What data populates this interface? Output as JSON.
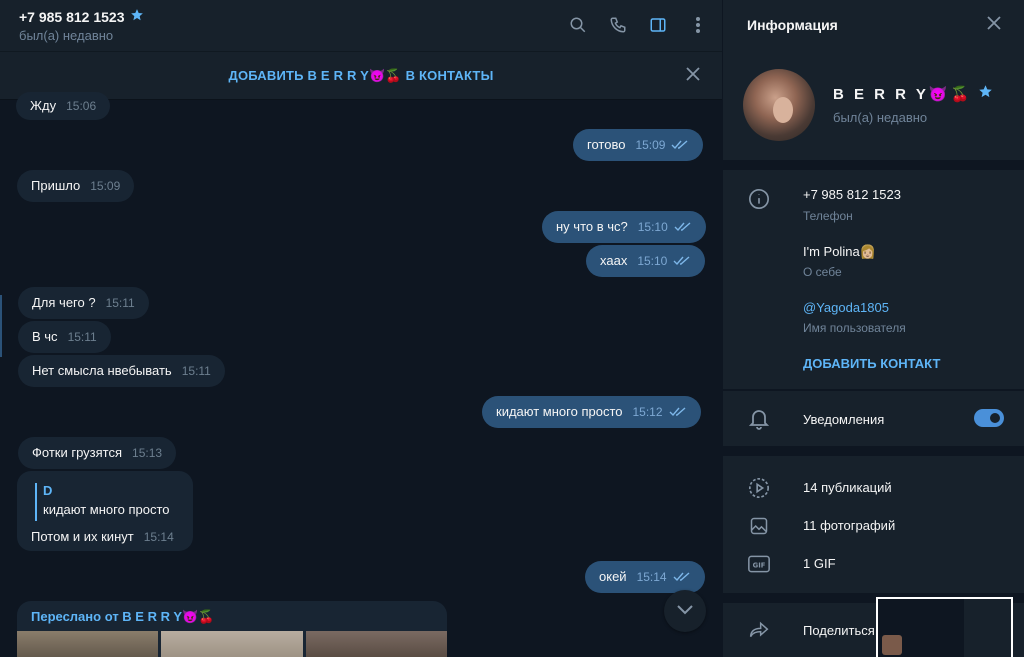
{
  "chat": {
    "title": "+7 985 812 1523",
    "status": "был(а) недавно",
    "banner": "ДОБАВИТЬ B E R R Y😈🍒 В КОНТАКТЫ",
    "messages": [
      {
        "dir": "in",
        "text": "Жду",
        "time": "15:06"
      },
      {
        "dir": "out",
        "text": "готово",
        "time": "15:09"
      },
      {
        "dir": "in",
        "text": "Пришло",
        "time": "15:09"
      },
      {
        "dir": "out",
        "text": "ну что в чс?",
        "time": "15:10"
      },
      {
        "dir": "out",
        "text": "хаах",
        "time": "15:10"
      },
      {
        "dir": "in",
        "text": "Для чего ?",
        "time": "15:11"
      },
      {
        "dir": "in",
        "text": "В чс",
        "time": "15:11"
      },
      {
        "dir": "in",
        "text": "Нет смысла нвебывать",
        "time": "15:11"
      },
      {
        "dir": "out",
        "text": "кидают много просто",
        "time": "15:12"
      },
      {
        "dir": "in",
        "text": "Фотки грузятся",
        "time": "15:13"
      },
      {
        "dir": "out",
        "text": "окей",
        "time": "15:14"
      }
    ],
    "reply": {
      "quote_name": "D",
      "quote_text": "кидают много просто",
      "text": "Потом и их кинут",
      "time": "15:14"
    },
    "forwarded_label": "Переслано от B E R R Y😈🍒"
  },
  "info": {
    "title": "Информация",
    "name": "B E R R Y😈🍒",
    "status": "был(а) недавно",
    "phone": "+7 985 812 1523",
    "phone_label": "Телефон",
    "bio": "I'm Polina👩🏼",
    "bio_label": "О себе",
    "username": "@Yagoda1805",
    "username_label": "Имя пользователя",
    "add_contact": "ДОБАВИТЬ КОНТАКТ",
    "notifications": "Уведомления",
    "notifications_on": true,
    "media": [
      {
        "icon": "video-icon",
        "label": "14 публикаций"
      },
      {
        "icon": "photo-icon",
        "label": "11 фотографий"
      },
      {
        "icon": "gif-icon",
        "label": "1 GIF"
      }
    ],
    "share": "Поделиться"
  },
  "colors": {
    "accent": "#5eb5f7",
    "bubble_out": "#2b5278",
    "bubble_in": "#182533",
    "bg": "#0e1621",
    "panel": "#17212b"
  }
}
